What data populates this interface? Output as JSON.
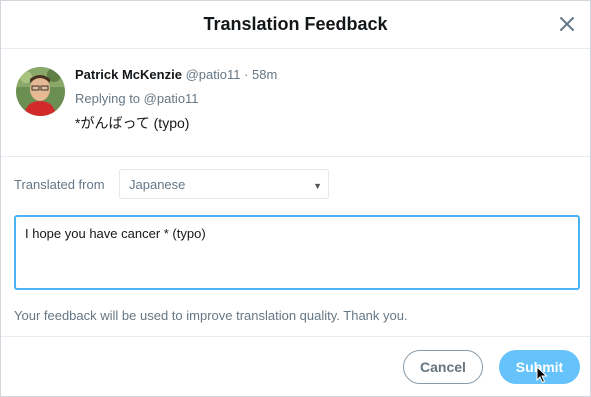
{
  "dialog": {
    "title": "Translation Feedback",
    "close_icon": "close-icon"
  },
  "tweet": {
    "author_name": "Patrick McKenzie",
    "handle": "@patio11",
    "separator": "·",
    "time": "58m",
    "reply_prefix": "Replying to ",
    "reply_handle": "@patio11",
    "text": "*がんばって (typo)"
  },
  "form": {
    "translated_from_label": "Translated from",
    "language_selected": "Japanese",
    "feedback_value": "I hope you have cancer * (typo)",
    "note": "Your feedback will be used to improve translation quality. Thank you."
  },
  "buttons": {
    "cancel": "Cancel",
    "submit": "Submit"
  },
  "colors": {
    "accent": "#1da1f2",
    "submit_bg": "#66c2fa",
    "focus_border": "#4ab3f4",
    "muted_text": "#657786"
  }
}
